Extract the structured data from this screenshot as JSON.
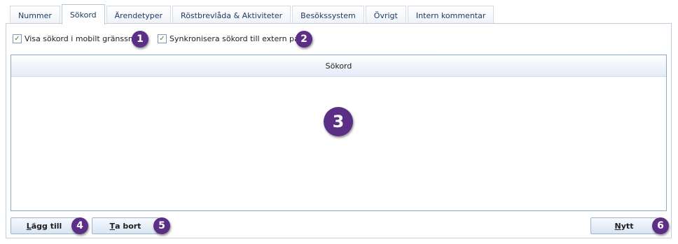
{
  "tabs": [
    {
      "label": "Nummer",
      "active": false
    },
    {
      "label": "Sökord",
      "active": true
    },
    {
      "label": "Ärendetyper",
      "active": false
    },
    {
      "label": "Röstbrevlåda & Aktiviteter",
      "active": false
    },
    {
      "label": "Besökssystem",
      "active": false
    },
    {
      "label": "Övrigt",
      "active": false
    },
    {
      "label": "Intern kommentar",
      "active": false
    }
  ],
  "options": {
    "show_mobile": {
      "label": "Visa sökord i mobilt gränssnitt",
      "checked": true
    },
    "sync_external": {
      "label": "Synkronisera sökord till extern part",
      "checked": true
    }
  },
  "list": {
    "column_header": "Sökord"
  },
  "buttons": {
    "add": {
      "mnemonic": "L",
      "rest": "ägg till"
    },
    "remove": {
      "mnemonic": "T",
      "rest": "a bort"
    },
    "new": {
      "mnemonic": "N",
      "rest": "ytt"
    }
  },
  "badges": [
    "1",
    "2",
    "3",
    "4",
    "5",
    "6"
  ],
  "colors": {
    "badge": "#5b2f86",
    "checkmark": "#2a8a32",
    "tab_text": "#1d3b66"
  }
}
